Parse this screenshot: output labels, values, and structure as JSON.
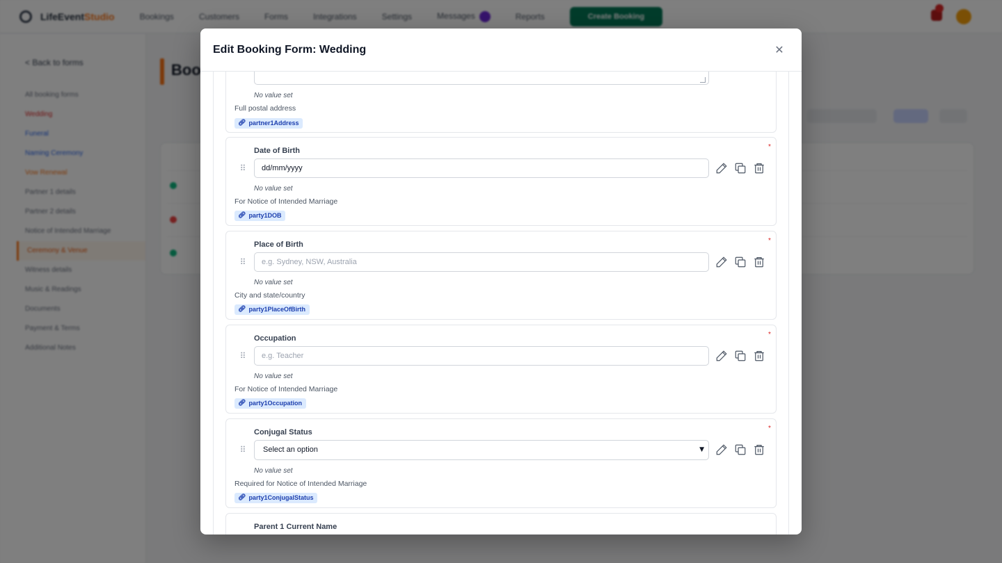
{
  "app": {
    "brand": "LifeEvent",
    "brand_accent": "Studio",
    "nav": [
      "Bookings",
      "Customers",
      "Forms",
      "Integrations",
      "Settings",
      "Messages",
      "Reports"
    ],
    "cta": "Create Booking",
    "back": "< Back to forms",
    "page_title": "Booking Forms"
  },
  "sidebar": {
    "items": [
      "All booking forms",
      "Wedding",
      "Funeral",
      "Naming Ceremony",
      "Vow Renewal",
      "Partner 1 details",
      "Partner 2 details",
      "Notice of Intended Marriage",
      "Ceremony & Venue",
      "Witness details",
      "Music & Readings",
      "Documents",
      "Payment & Terms",
      "Additional Notes"
    ]
  },
  "modal": {
    "title": "Edit Booking Form: Wedding",
    "close_icon": "close-icon",
    "top_partial": {
      "no_value": "No value set",
      "helper": "Full postal address",
      "key": "partner1Address"
    },
    "fields": [
      {
        "label": "Date of Birth",
        "value": "dd/mm/yyyy",
        "placeholder": "",
        "no_value": "No value set",
        "helper": "For Notice of Intended Marriage",
        "key": "party1DOB",
        "required": "*"
      },
      {
        "label": "Place of Birth",
        "value": "",
        "placeholder": "e.g. Sydney, NSW, Australia",
        "no_value": "No value set",
        "helper": "City and state/country",
        "key": "party1PlaceOfBirth",
        "required": "*"
      },
      {
        "label": "Occupation",
        "value": "",
        "placeholder": "e.g. Teacher",
        "no_value": "No value set",
        "helper": "For Notice of Intended Marriage",
        "key": "party1Occupation",
        "required": "*"
      },
      {
        "label": "Conjugal Status",
        "select": "Select an option",
        "no_value": "No value set",
        "helper": "Required for Notice of Intended Marriage",
        "key": "party1ConjugalStatus",
        "required": "*"
      }
    ],
    "next_field_label": "Parent 1 Current Name"
  },
  "colors": {
    "backdrop": "#00000080",
    "required": "#dc2626",
    "key_chip_bg": "#dbeafe",
    "key_chip_text": "#1e40af",
    "cta": "#047857",
    "accent": "#f97316"
  }
}
